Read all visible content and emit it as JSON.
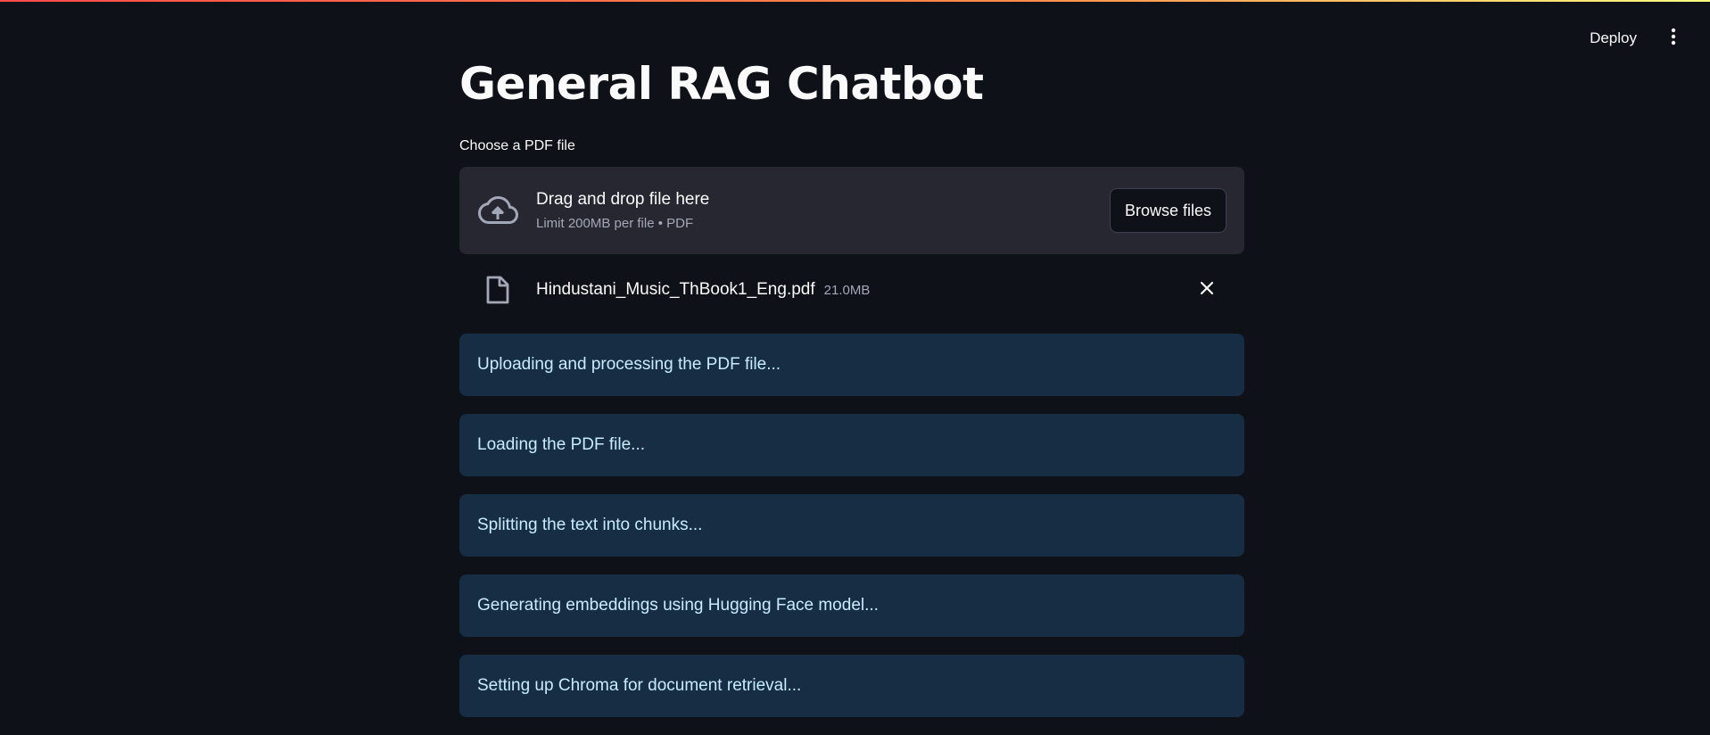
{
  "header": {
    "deploy_label": "Deploy",
    "menu_icon": "vertical-dots-icon"
  },
  "page": {
    "title": "General RAG Chatbot"
  },
  "uploader": {
    "label": "Choose a PDF file",
    "drop_title": "Drag and drop file here",
    "drop_hint": "Limit 200MB per file • PDF",
    "browse_label": "Browse files",
    "upload_icon": "cloud-upload-icon"
  },
  "uploaded_file": {
    "name": "Hindustani_Music_ThBook1_Eng.pdf",
    "size": "21.0MB",
    "file_icon": "file-icon",
    "remove_icon": "close-icon"
  },
  "status_messages": [
    "Uploading and processing the PDF file...",
    "Loading the PDF file...",
    "Splitting the text into chunks...",
    "Generating embeddings using Hugging Face model...",
    "Setting up Chroma for document retrieval..."
  ],
  "colors": {
    "background": "#0e1117",
    "dropzone_bg": "#262730",
    "info_bg": "#172d43",
    "info_text": "#c7ebff",
    "muted_text": "#a3a8b8"
  }
}
